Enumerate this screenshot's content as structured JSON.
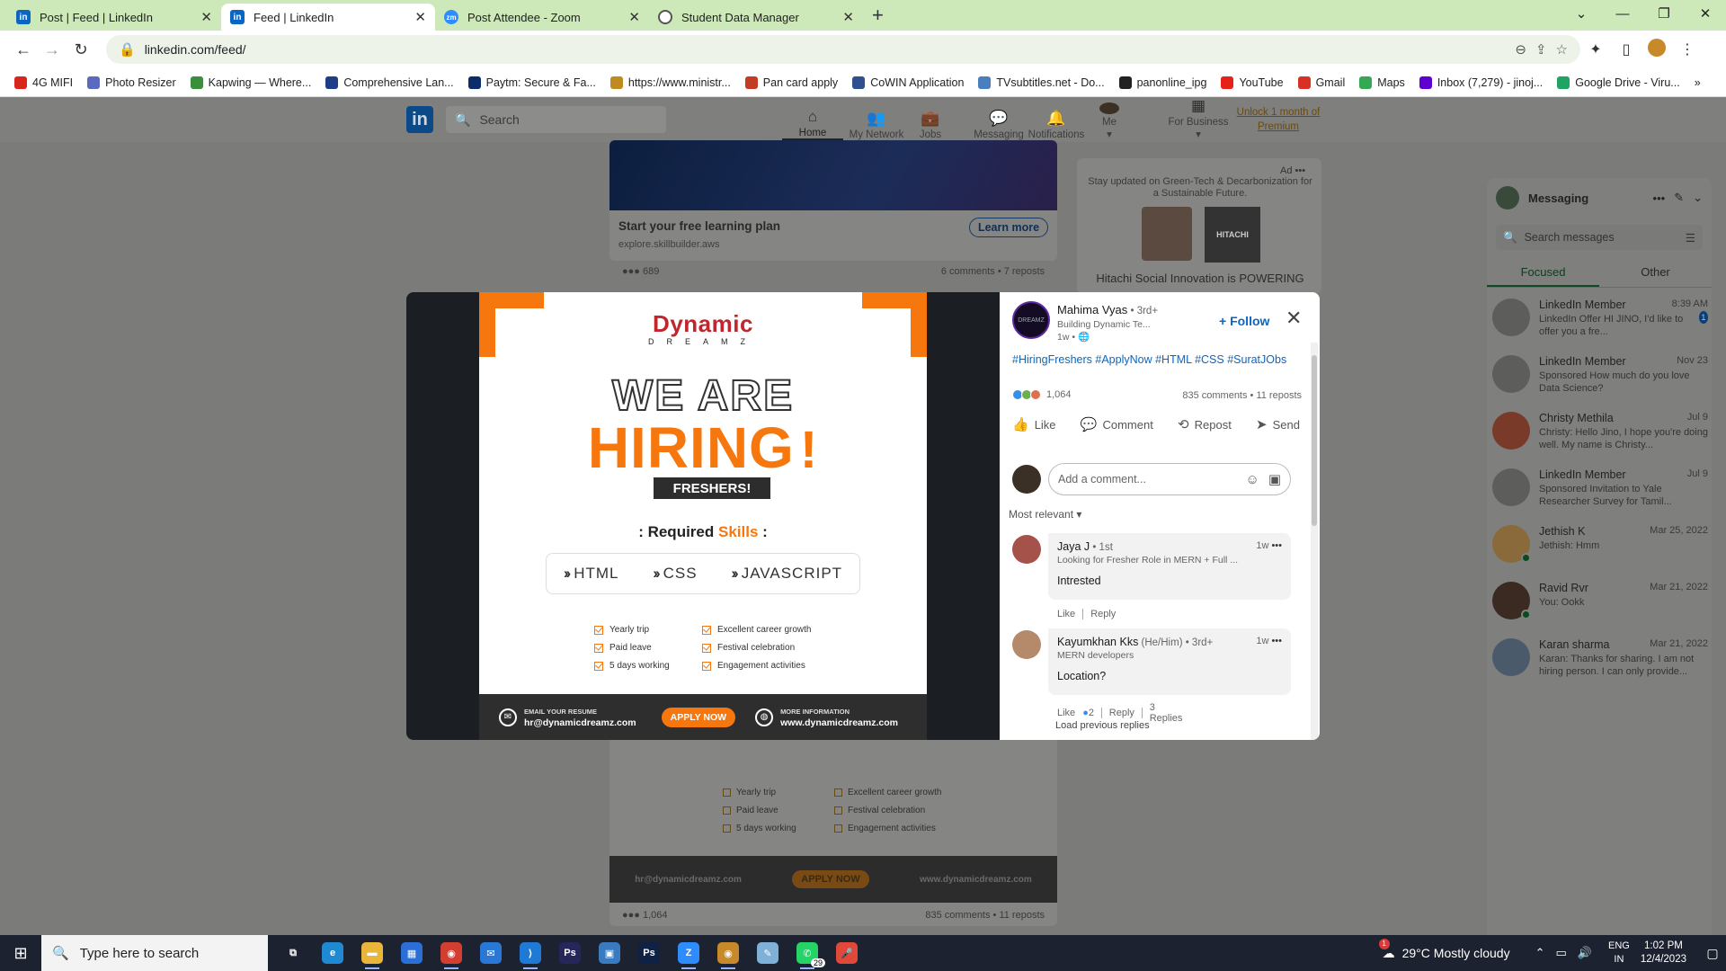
{
  "browser": {
    "tabs": [
      {
        "title": "Post | Feed | LinkedIn",
        "favicon": "linkedin-icon",
        "active": false
      },
      {
        "title": "Feed | LinkedIn",
        "favicon": "linkedin-icon",
        "active": true
      },
      {
        "title": "Post Attendee - Zoom",
        "favicon": "zoom-icon",
        "active": false
      },
      {
        "title": "Student Data Manager",
        "favicon": "globe-icon",
        "active": false
      }
    ],
    "url": "linkedin.com/feed/",
    "bookmarks": [
      {
        "label": "4G MIFI",
        "color": "#d9261c"
      },
      {
        "label": "Photo Resizer",
        "color": "#5b6abf"
      },
      {
        "label": "Kapwing — Where...",
        "color": "#3a8f3a"
      },
      {
        "label": "Comprehensive Lan...",
        "color": "#1d3e86"
      },
      {
        "label": "Paytm: Secure & Fa...",
        "color": "#0b2e6b"
      },
      {
        "label": "https://www.ministr...",
        "color": "#c08a20"
      },
      {
        "label": "Pan card apply",
        "color": "#c23b22"
      },
      {
        "label": "CoWIN Application",
        "color": "#2f4f8f"
      },
      {
        "label": "TVsubtitles.net - Do...",
        "color": "#4a7fbf"
      },
      {
        "label": "panonline_ipg",
        "color": "#222222"
      },
      {
        "label": "YouTube",
        "color": "#e62117"
      },
      {
        "label": "Gmail",
        "color": "#d93025"
      },
      {
        "label": "Maps",
        "color": "#34a853"
      },
      {
        "label": "Inbox (7,279) - jinoj...",
        "color": "#6001d2"
      },
      {
        "label": "Google Drive - Viru...",
        "color": "#1fa463"
      }
    ]
  },
  "linkedin": {
    "search_placeholder": "Search",
    "nav": [
      {
        "label": "Home",
        "icon": "home-icon",
        "glyph": "⌂"
      },
      {
        "label": "My Network",
        "icon": "network-icon",
        "glyph": "👥"
      },
      {
        "label": "Jobs",
        "icon": "briefcase-icon",
        "glyph": "💼"
      },
      {
        "label": "Messaging",
        "icon": "messaging-icon",
        "glyph": "💬"
      },
      {
        "label": "Notifications",
        "icon": "bell-icon",
        "glyph": "🔔"
      },
      {
        "label": "Me",
        "icon": "avatar",
        "glyph": "●"
      },
      {
        "label": "For Business",
        "icon": "grid-icon",
        "glyph": "▦"
      }
    ],
    "premium": "Unlock 1 month of Premium",
    "bg_post": {
      "title": "Start your free learning plan",
      "link": "explore.skillbuilder.aws",
      "cta": "Learn more",
      "reactions": "689",
      "comments": "6 comments • 7 reposts"
    },
    "ad": {
      "label": "Ad",
      "text": "Stay updated on Green-Tech & Decarbonization for a Sustainable Future.",
      "caption": "Hitachi Social Innovation is POWERING",
      "brand": "HITACHI"
    },
    "bg_post2": {
      "reactions": "1,064",
      "comments": "835 comments • 11 reposts"
    }
  },
  "messaging": {
    "title": "Messaging",
    "search_placeholder": "Search messages",
    "tabs": [
      "Focused",
      "Other"
    ],
    "conversations": [
      {
        "name": "LinkedIn Member",
        "date": "8:39 AM",
        "preview": "LinkedIn Offer  HI JINO, I'd like to offer you a fre...",
        "unread": "1",
        "online": false
      },
      {
        "name": "LinkedIn Member",
        "date": "Nov 23",
        "preview": "Sponsored  How much do you love Data Science?",
        "unread": "",
        "online": false
      },
      {
        "name": "Christy Methila",
        "date": "Jul 9",
        "preview": "Christy: Hello Jino, I hope you're doing well. My name is Christy...",
        "unread": "",
        "online": false
      },
      {
        "name": "LinkedIn Member",
        "date": "Jul 9",
        "preview": "Sponsored  Invitation to Yale Researcher Survey for Tamil...",
        "unread": "",
        "online": false
      },
      {
        "name": "Jethish K",
        "date": "Mar 25, 2022",
        "preview": "Jethish: Hmm",
        "unread": "",
        "online": true
      },
      {
        "name": "Ravid Rvr",
        "date": "Mar 21, 2022",
        "preview": "You: Ookk",
        "unread": "",
        "online": true
      },
      {
        "name": "Karan sharma",
        "date": "Mar 21, 2022",
        "preview": "Karan: Thanks for sharing. I am not hiring person. I can only provide...",
        "unread": "",
        "online": false
      }
    ]
  },
  "hiring_image": {
    "brand": "Dynamic",
    "brand_sub": "DREAMZ",
    "headline1": "WE ARE",
    "headline2": "HIRING",
    "exclaim": "!",
    "badge": "FRESHERS!",
    "required_prefix": ": Required ",
    "required_highlight": "Skills",
    "required_suffix": " :",
    "skills": [
      "HTML",
      "CSS",
      "JAVASCRIPT"
    ],
    "perks_left": [
      "Yearly trip",
      "Paid leave",
      "5 days working"
    ],
    "perks_right": [
      "Excellent career growth",
      "Festival celebration",
      "Engagement activities"
    ],
    "email_label": "EMAIL YOUR RESUME",
    "email": "hr@dynamicdreamz.com",
    "apply": "APPLY NOW",
    "info_label": "MORE INFORMATION",
    "website": "www.dynamicdreamz.com"
  },
  "post": {
    "author": "Mahima Vyas",
    "degree": " • 3rd+",
    "headline": "Building Dynamic Te...",
    "time": "1w •",
    "follow": "Follow",
    "hashtags": "#HiringFreshers #ApplyNow #HTML #CSS #SuratJObs",
    "reactions": "1,064",
    "comments_summary": "835 comments • 11 reposts",
    "actions": [
      {
        "label": "Like",
        "icon": "like-icon",
        "glyph": "👍"
      },
      {
        "label": "Comment",
        "icon": "comment-icon",
        "glyph": "💬"
      },
      {
        "label": "Repost",
        "icon": "repost-icon",
        "glyph": "⟲"
      },
      {
        "label": "Send",
        "icon": "send-icon",
        "glyph": "➤"
      }
    ],
    "comment_placeholder": "Add a comment...",
    "sort": "Most relevant ▾",
    "comments": [
      {
        "name": "Jaya J",
        "degree": " • 1st",
        "headline": "Looking for Fresher Role in MERN + Full ...",
        "time": "1w",
        "text": "Intrested",
        "like": "Like",
        "reply": "Reply",
        "likes": "",
        "replies": ""
      },
      {
        "name": "Kayumkhan Kks",
        "degree": " (He/Him) • 3rd+",
        "headline": "MERN developers",
        "time": "1w",
        "text": "Location?",
        "like": "Like",
        "reply": "Reply",
        "likes": "2",
        "replies": "3 Replies"
      }
    ],
    "load_previous": "Load previous replies"
  },
  "taskbar": {
    "search_placeholder": "Type here to search",
    "apps": [
      {
        "name": "task-view-icon",
        "glyph": "⧉",
        "color": "#1d2230",
        "running": false
      },
      {
        "name": "edge-icon",
        "glyph": "e",
        "color": "#1f8ad2",
        "running": false
      },
      {
        "name": "file-explorer-icon",
        "glyph": "▬",
        "color": "#e9b53a",
        "running": true
      },
      {
        "name": "store-icon",
        "glyph": "▦",
        "color": "#2b6fd6",
        "running": false
      },
      {
        "name": "chrome-icon",
        "glyph": "◉",
        "color": "#d23f31",
        "running": true
      },
      {
        "name": "mail-icon",
        "glyph": "✉",
        "color": "#2a78d6",
        "running": false
      },
      {
        "name": "vscode-icon",
        "glyph": "⟩",
        "color": "#1f7ad6",
        "running": true
      },
      {
        "name": "premiere-icon",
        "glyph": "Ps",
        "color": "#26265a",
        "running": false
      },
      {
        "name": "photos-icon",
        "glyph": "▣",
        "color": "#3a7bbf",
        "running": false
      },
      {
        "name": "photoshop-icon",
        "glyph": "Ps",
        "color": "#0f2244",
        "running": false
      },
      {
        "name": "zoom-icon",
        "glyph": "Z",
        "color": "#2d8cff",
        "running": true
      },
      {
        "name": "chrome-profile-icon",
        "glyph": "◉",
        "color": "#c7892a",
        "running": true
      },
      {
        "name": "notepad-icon",
        "glyph": "✎",
        "color": "#7fb0d8",
        "running": false
      },
      {
        "name": "whatsapp-icon",
        "glyph": "✆",
        "color": "#25d366",
        "running": true
      },
      {
        "name": "microphone-icon",
        "glyph": "🎤",
        "color": "#e0483a",
        "running": false
      }
    ],
    "whatsapp_badge": "29",
    "weather_badge": "1",
    "weather": "29°C  Mostly cloudy",
    "lang": "ENG",
    "region": "IN",
    "time": "1:02 PM",
    "date": "12/4/2023"
  }
}
